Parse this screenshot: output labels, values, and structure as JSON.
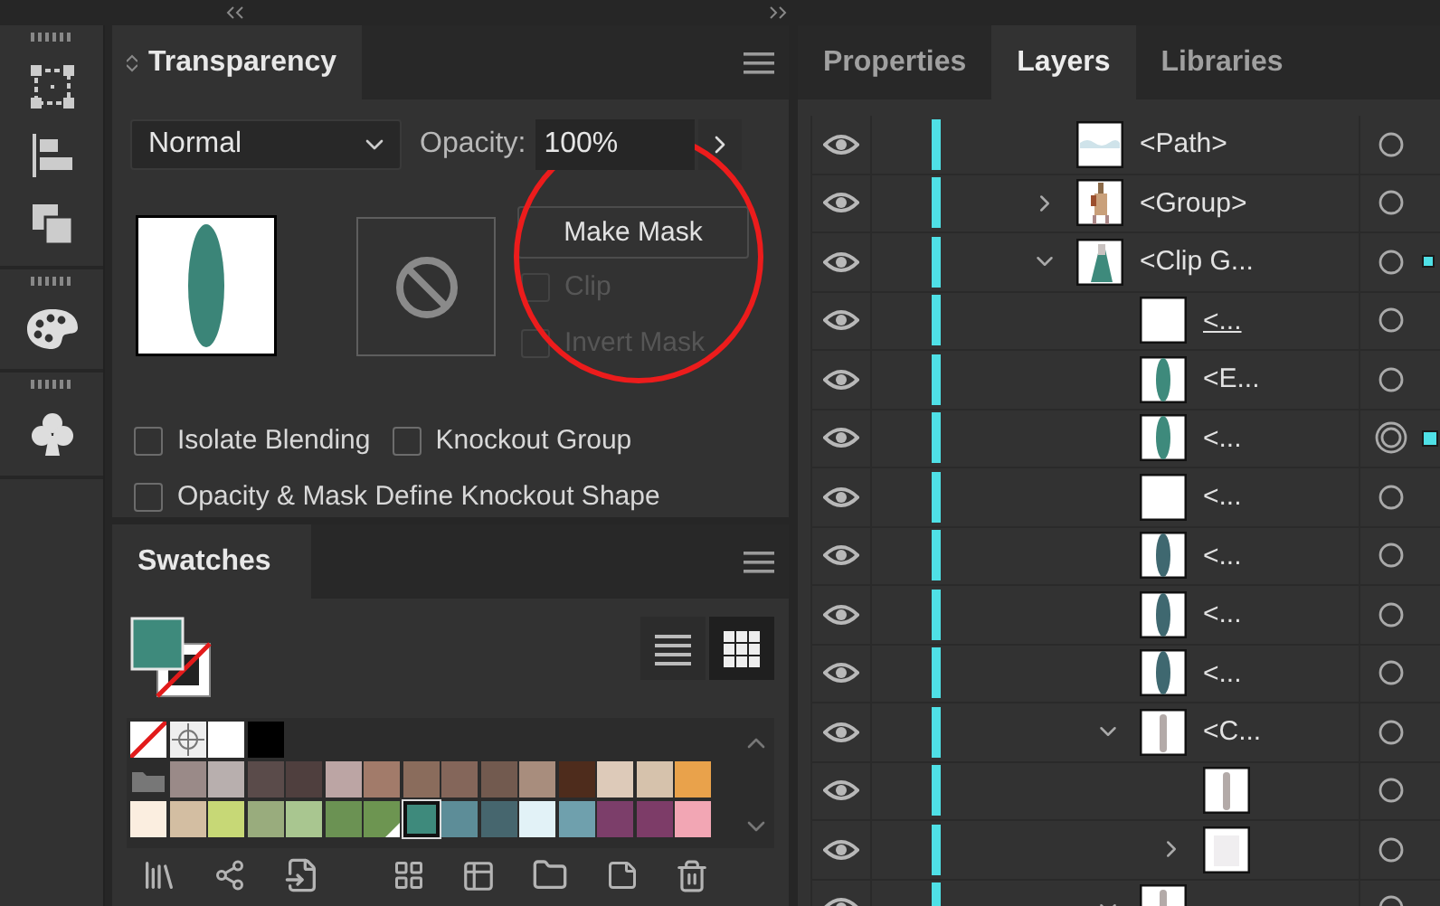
{
  "transparency": {
    "tab": "Transparency",
    "blend_mode": "Normal",
    "opacity_label": "Opacity:",
    "opacity": "100%",
    "make_mask": "Make Mask",
    "highlight_circle": true,
    "mask_options": [
      {
        "label": "Clip",
        "checked": false,
        "disabled": true
      },
      {
        "label": "Invert Mask",
        "checked": false,
        "disabled": true
      }
    ],
    "checkbox_rows": [
      [
        {
          "label": "Isolate Blending",
          "checked": false
        },
        {
          "label": "Knockout Group",
          "checked": false
        }
      ],
      [
        {
          "label": "Opacity & Mask Define Knockout Shape",
          "checked": false
        }
      ]
    ]
  },
  "swatches": {
    "tab": "Swatches",
    "views": [
      {
        "kind": "list",
        "selected": false
      },
      {
        "kind": "grid",
        "selected": true
      }
    ],
    "rows": [
      {
        "kind": "special",
        "items": [
          {
            "kind": "none",
            "selected": false
          },
          {
            "kind": "registration",
            "selected": false
          },
          {
            "kind": "color",
            "color": "#ffffff",
            "selected": false
          },
          {
            "kind": "color",
            "color": "#000000",
            "selected": false
          }
        ]
      },
      {
        "kind": "group",
        "items": [
          {
            "kind": "color",
            "color": "#9a8a88",
            "selected": false
          },
          {
            "kind": "color",
            "color": "#b8afae",
            "selected": false
          },
          {
            "kind": "color",
            "color": "#5a4b4a",
            "selected": false
          },
          {
            "kind": "color",
            "color": "#4f3f3e",
            "selected": false
          },
          {
            "kind": "color",
            "color": "#bca5a4",
            "selected": false
          },
          {
            "kind": "color",
            "color": "#a27b6a",
            "selected": false
          },
          {
            "kind": "color",
            "color": "#8a6c5c",
            "selected": false
          },
          {
            "kind": "color",
            "color": "#84665a",
            "selected": false
          },
          {
            "kind": "color",
            "color": "#725a4f",
            "selected": false
          },
          {
            "kind": "color",
            "color": "#a88d7d",
            "selected": false
          },
          {
            "kind": "color",
            "color": "#4e2c1c",
            "selected": false
          },
          {
            "kind": "color",
            "color": "#ddcab9",
            "selected": false
          },
          {
            "kind": "color",
            "color": "#d6c2ac",
            "selected": false
          },
          {
            "kind": "color",
            "color": "#e9a24b",
            "selected": false
          }
        ]
      },
      {
        "kind": "plain",
        "items": [
          {
            "kind": "color",
            "color": "#fbeee0",
            "selected": false
          },
          {
            "kind": "color",
            "color": "#d3bea2",
            "selected": false
          },
          {
            "kind": "color",
            "color": "#c7d876",
            "selected": false
          },
          {
            "kind": "color",
            "color": "#99ac7d",
            "selected": false
          },
          {
            "kind": "color",
            "color": "#a9c690",
            "selected": false
          },
          {
            "kind": "color",
            "color": "#6b9253",
            "selected": false
          },
          {
            "kind": "global",
            "color": "#6d9551",
            "selected": false
          },
          {
            "kind": "color",
            "color": "#3e8a7c",
            "selected": true
          },
          {
            "kind": "color",
            "color": "#5d8d98",
            "selected": false
          },
          {
            "kind": "color",
            "color": "#46666e",
            "selected": false
          },
          {
            "kind": "color",
            "color": "#e2f2f7",
            "selected": false
          },
          {
            "kind": "color",
            "color": "#6fa0ad",
            "selected": false
          },
          {
            "kind": "color",
            "color": "#7c3e6a",
            "selected": false
          },
          {
            "kind": "color",
            "color": "#7d3c68",
            "selected": false
          },
          {
            "kind": "color",
            "color": "#f2a6b4",
            "selected": false
          }
        ]
      }
    ]
  },
  "layers": {
    "tabs": [
      {
        "label": "Properties",
        "selected": false
      },
      {
        "label": "Layers",
        "selected": true
      },
      {
        "label": "Libraries",
        "selected": false
      }
    ],
    "rows": [
      {
        "kind": "item",
        "name": "<Path>",
        "thumb": {
          "kind": "mist"
        },
        "visible": true,
        "clipping": false,
        "targeted": false,
        "selected": false,
        "contains_selection": false
      },
      {
        "kind": "group",
        "name": "<Group>",
        "thumb": {
          "kind": "figure"
        },
        "expanded": false,
        "visible": true,
        "clipping": false,
        "targeted": false,
        "selected": false,
        "contains_selection": false
      },
      {
        "kind": "group",
        "name": "<Clip G...",
        "thumb": {
          "kind": "cloak"
        },
        "expanded": true,
        "visible": true,
        "clipping": false,
        "targeted": false,
        "selected": false,
        "contains_selection": true,
        "children": [
          {
            "kind": "item",
            "name": "<...",
            "thumb": {
              "kind": "white"
            },
            "visible": true,
            "clipping": true,
            "targeted": false,
            "selected": false,
            "contains_selection": false
          },
          {
            "kind": "item",
            "name": "<E...",
            "thumb": {
              "kind": "leaf"
            },
            "visible": true,
            "clipping": false,
            "targeted": false,
            "selected": false,
            "contains_selection": false
          },
          {
            "kind": "item",
            "name": "<...",
            "thumb": {
              "kind": "leaf"
            },
            "visible": true,
            "clipping": false,
            "targeted": true,
            "selected": true
          },
          {
            "kind": "item",
            "name": "<...",
            "thumb": {
              "kind": "white"
            },
            "visible": true,
            "clipping": false,
            "targeted": false,
            "selected": false,
            "contains_selection": false
          },
          {
            "kind": "item",
            "name": "<...",
            "thumb": {
              "kind": "slate"
            },
            "visible": true,
            "clipping": false,
            "targeted": false,
            "selected": false,
            "contains_selection": false
          },
          {
            "kind": "item",
            "name": "<...",
            "thumb": {
              "kind": "slate"
            },
            "visible": true,
            "clipping": false,
            "targeted": false,
            "selected": false,
            "contains_selection": false
          },
          {
            "kind": "item",
            "name": "<...",
            "thumb": {
              "kind": "slate"
            },
            "visible": true,
            "clipping": false,
            "targeted": false,
            "selected": false,
            "contains_selection": false
          },
          {
            "kind": "group",
            "name": "<C...",
            "thumb": {
              "kind": "bar"
            },
            "expanded": true,
            "visible": true,
            "clipping": false,
            "targeted": false,
            "selected": false,
            "contains_selection": false,
            "children": [
              {
                "kind": "item",
                "thumb": {
                  "kind": "bar"
                },
                "visible": true,
                "targeted": false,
                "selected": false,
                "contains_selection": false
              },
              {
                "kind": "group",
                "thumb": {
                  "kind": "haze"
                },
                "expanded": false,
                "visible": true,
                "targeted": false,
                "selected": false,
                "contains_selection": false
              }
            ]
          },
          {
            "kind": "group",
            "thumb": {
              "kind": "bar"
            },
            "expanded": true,
            "visible": true,
            "targeted": false,
            "selected": false,
            "contains_selection": false
          }
        ]
      }
    ]
  }
}
